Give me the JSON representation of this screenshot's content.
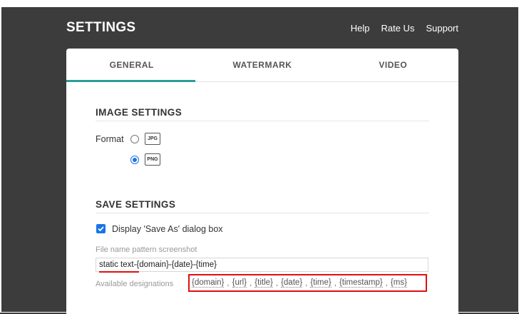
{
  "header": {
    "title": "SETTINGS",
    "links": [
      "Help",
      "Rate Us",
      "Support"
    ]
  },
  "tabs": [
    {
      "label": "GENERAL",
      "active": true
    },
    {
      "label": "WATERMARK",
      "active": false
    },
    {
      "label": "VIDEO",
      "active": false
    }
  ],
  "image_settings": {
    "title": "IMAGE SETTINGS",
    "format_label": "Format",
    "options": [
      {
        "label": "JPG",
        "checked": false
      },
      {
        "label": "PNG",
        "checked": true
      }
    ]
  },
  "save_settings": {
    "title": "SAVE SETTINGS",
    "save_as_dialog": {
      "label": "Display 'Save As' dialog box",
      "checked": true
    },
    "pattern_label": "File name pattern screenshot",
    "pattern_value": "static text-{domain}-{date}-{time}",
    "available_label": "Available designations",
    "designations": [
      "{domain}",
      "{url}",
      "{title}",
      "{date}",
      "{time}",
      "{timestamp}",
      "{ms}"
    ],
    "separator": ","
  },
  "colors": {
    "accent": "#2a9d9a",
    "checkbox": "#1a73e8",
    "highlight": "#e01010",
    "background": "#3c3c3c"
  }
}
